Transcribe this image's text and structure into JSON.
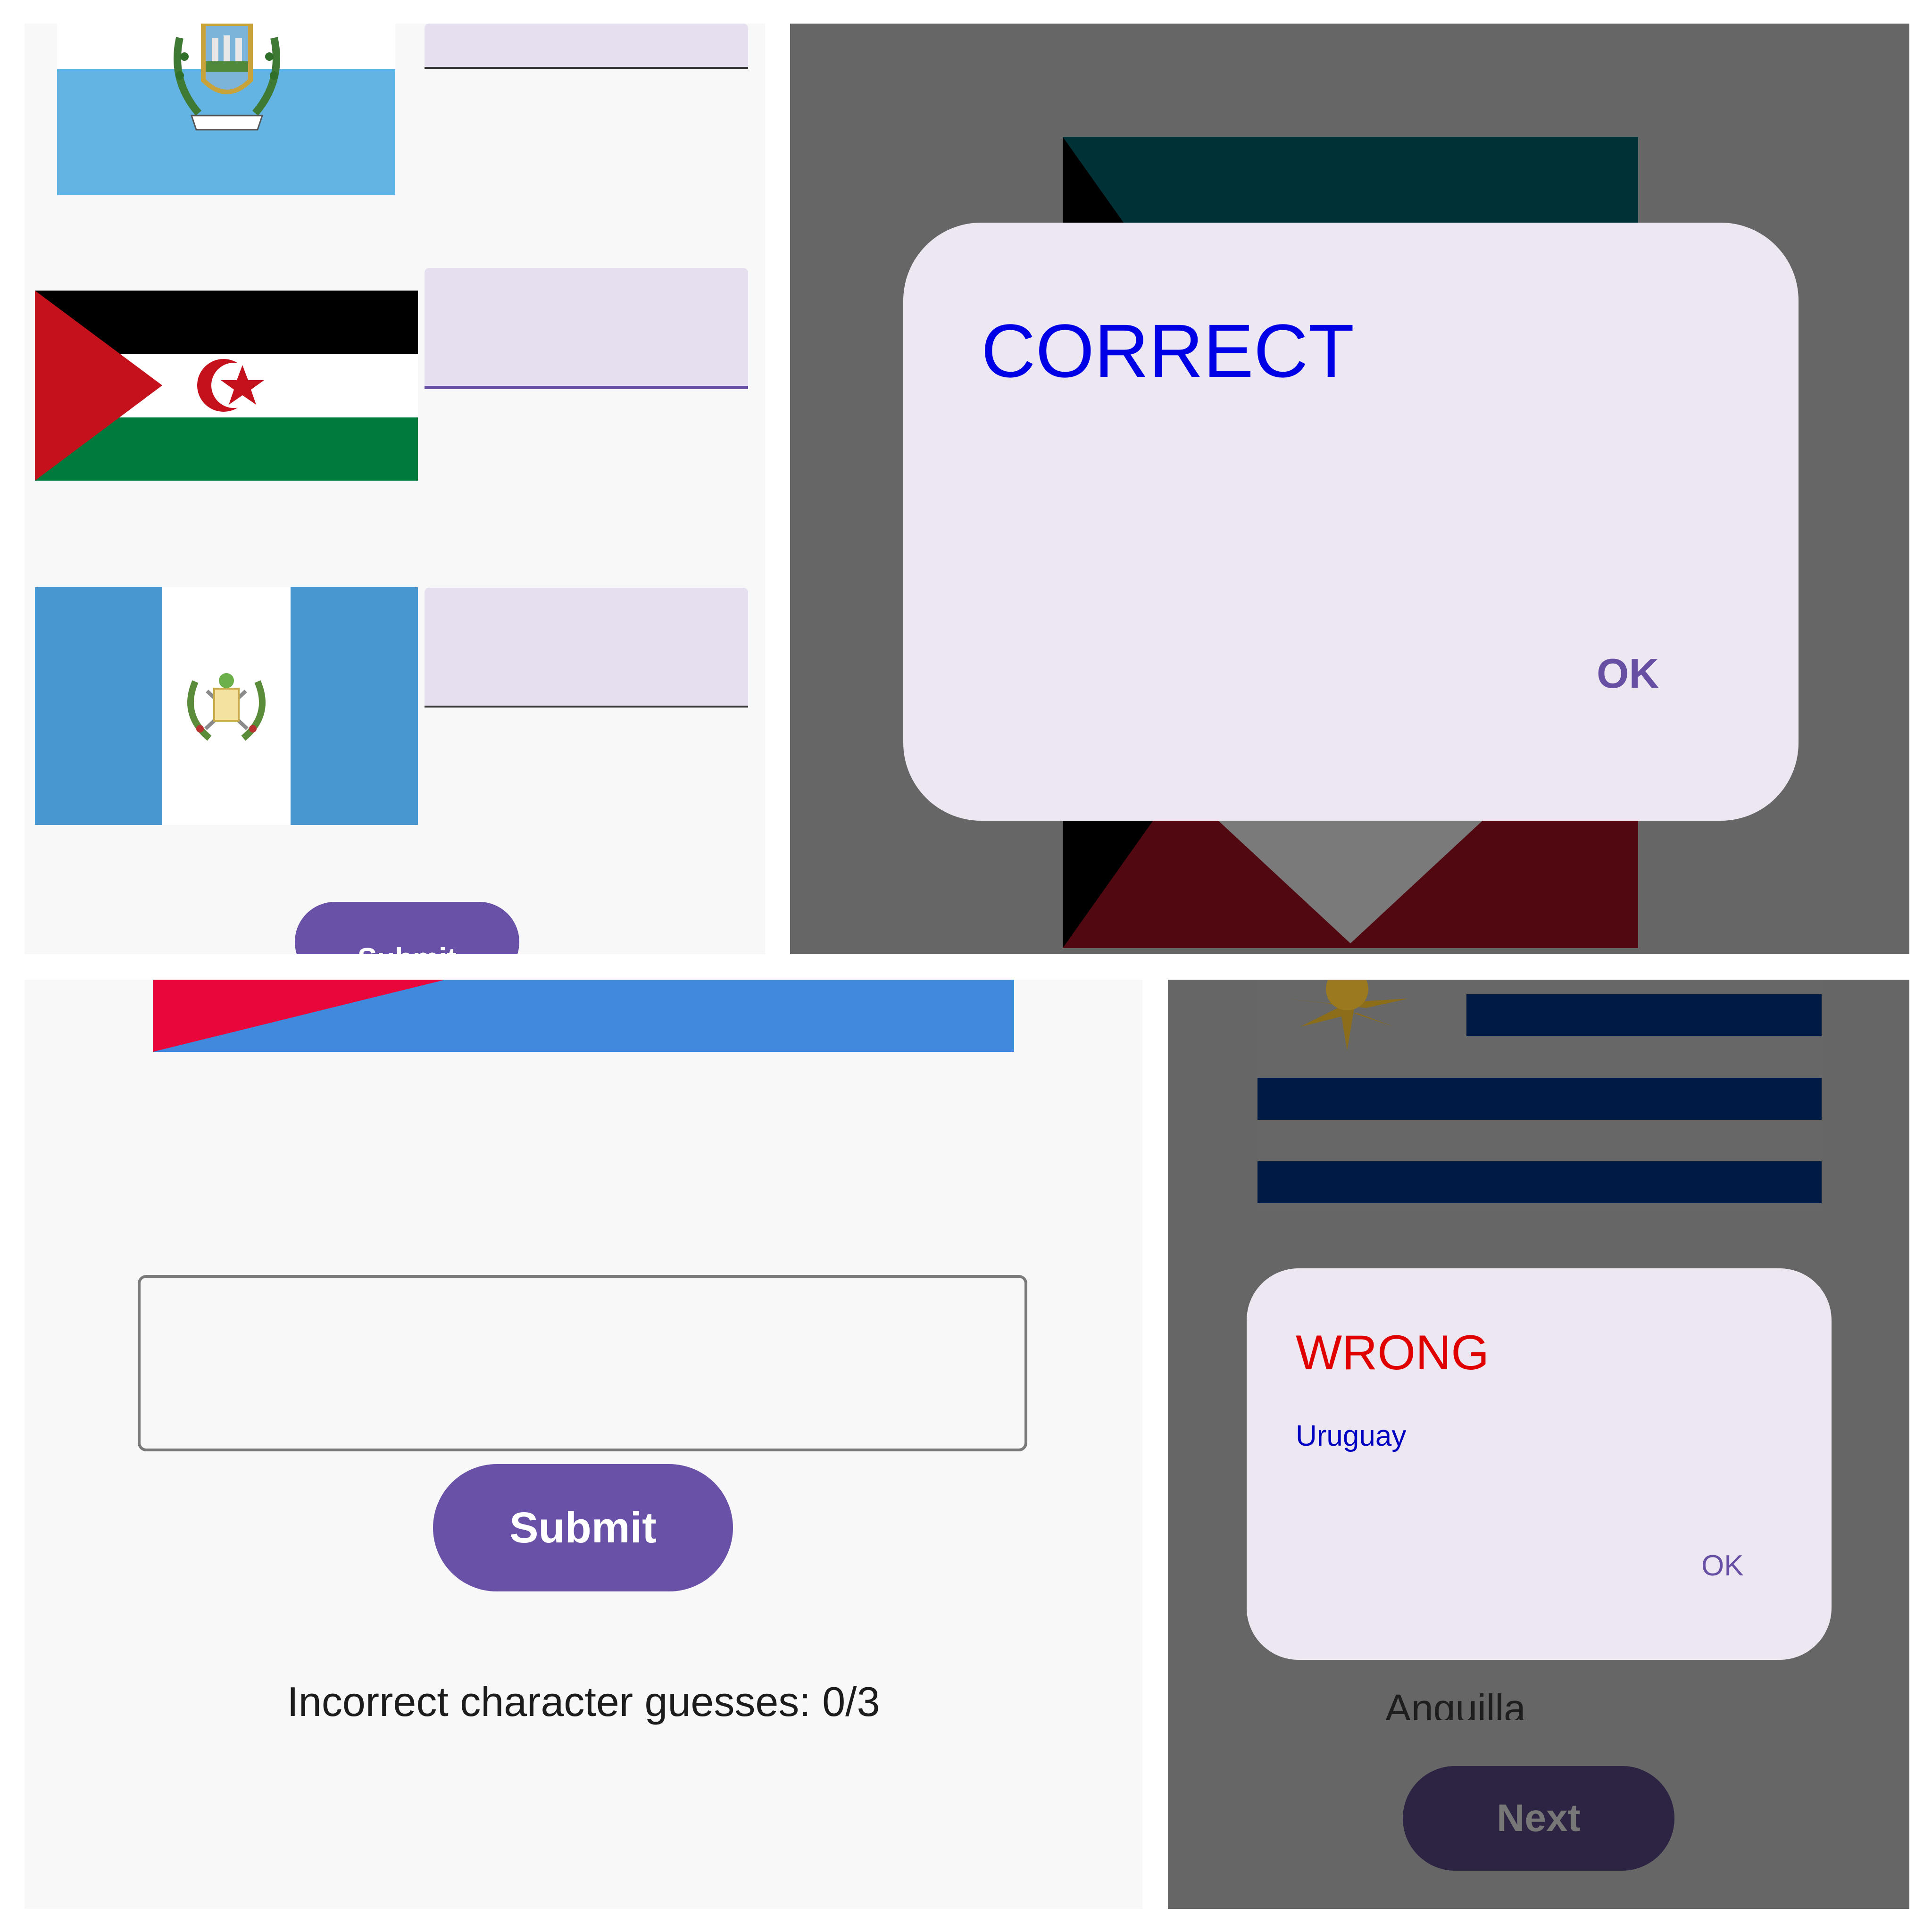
{
  "panel_multi_flag": {
    "submit_label": "Submit"
  },
  "panel_correct": {
    "dialog_title": "CORRECT",
    "ok_label": "OK",
    "title_color": "#0000e6"
  },
  "panel_hangman": {
    "blanks": "_ _ _ _ _ _ _",
    "submit_label": "Submit",
    "guesses_text": "Incorrect character guesses: 0/3"
  },
  "panel_wrong": {
    "dialog_title": "WRONG",
    "answer": "Uruguay",
    "ok_label": "OK",
    "behind_label": "Anguilla",
    "next_label": "Next",
    "title_color": "#e00000"
  },
  "colors": {
    "accent": "#6a51a8",
    "dialog_surface": "#ede7f2",
    "scrim": "#666666"
  },
  "icons": [
    "san-marino-flag",
    "western-sahara-flag",
    "guatemala-flag",
    "philippines-flag",
    "czech-flag",
    "uruguay-flag"
  ]
}
